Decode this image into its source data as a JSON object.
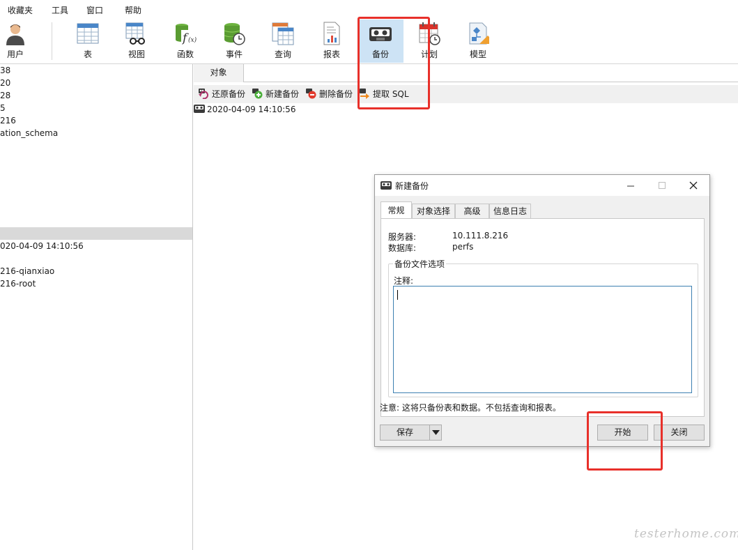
{
  "menu": [
    "收藏夹",
    "工具",
    "窗口",
    "帮助"
  ],
  "toolbar": {
    "items": [
      {
        "label": "用户",
        "icon": "user-icon"
      },
      {
        "label": "表",
        "icon": "table-icon"
      },
      {
        "label": "视图",
        "icon": "view-icon"
      },
      {
        "label": "函数",
        "icon": "function-icon"
      },
      {
        "label": "事件",
        "icon": "event-icon"
      },
      {
        "label": "查询",
        "icon": "query-icon"
      },
      {
        "label": "报表",
        "icon": "report-icon"
      },
      {
        "label": "备份",
        "icon": "backup-icon",
        "active": true
      },
      {
        "label": "计划",
        "icon": "schedule-icon"
      },
      {
        "label": "模型",
        "icon": "model-icon"
      }
    ]
  },
  "tree": {
    "items": [
      "38",
      "20",
      "28",
      "5",
      "216",
      "ation_schema",
      "020-04-09 14:10:56",
      "216-qianxiao",
      "216-root"
    ]
  },
  "content": {
    "tab_label": "对象",
    "actions": [
      {
        "label": "还原备份",
        "icon": "restore-icon"
      },
      {
        "label": "新建备份",
        "icon": "new-backup-icon"
      },
      {
        "label": "删除备份",
        "icon": "delete-backup-icon"
      },
      {
        "label": "提取 SQL",
        "icon": "extract-sql-icon"
      }
    ],
    "backup_file": "2020-04-09 14:10:56"
  },
  "dialog": {
    "title": "新建备份",
    "tabs": [
      "常规",
      "对象选择",
      "高级",
      "信息日志"
    ],
    "active_tab": "常规",
    "server_label": "服务器:",
    "server_value": "10.111.8.216",
    "database_label": "数据库:",
    "database_value": "perfs",
    "group_title": "备份文件选项",
    "comment_label": "注释:",
    "comment_value": "",
    "note": "注意: 这将只备份表和数据。不包括查询和报表。",
    "save_label": "保存",
    "start_label": "开始",
    "close_label": "关闭"
  },
  "watermark": "testerhome.com",
  "colors": {
    "highlight": "#e8302a",
    "active_tab_bg": "#cde3f5",
    "input_border": "#3c7fb1"
  }
}
